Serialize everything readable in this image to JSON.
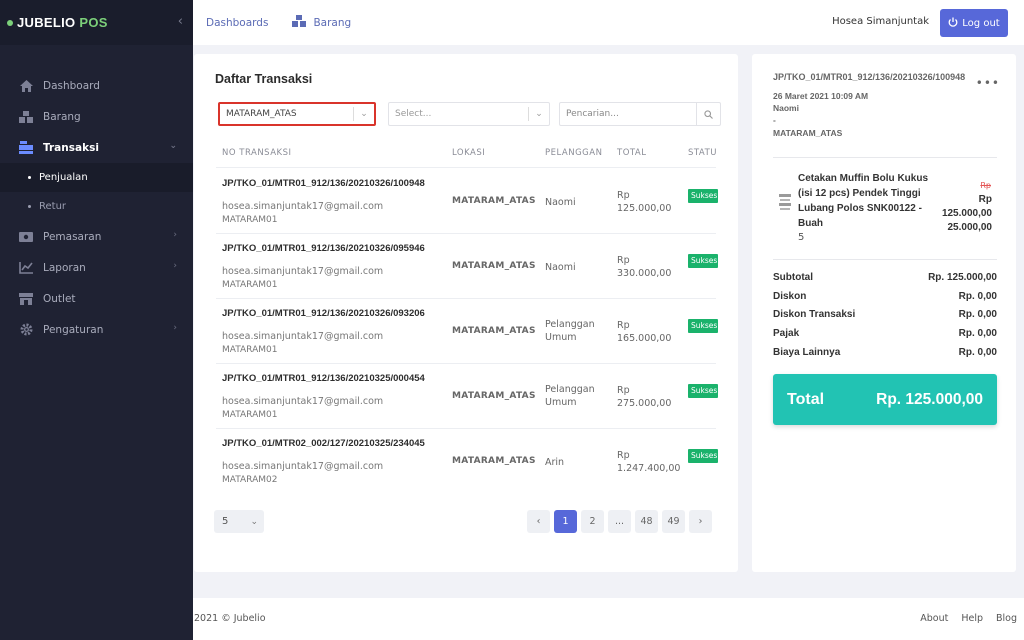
{
  "brand": {
    "name": "JUBELIO",
    "suffix": "POS"
  },
  "sidebar": {
    "items": [
      {
        "label": "Dashboard",
        "icon": "home-icon"
      },
      {
        "label": "Barang",
        "icon": "boxes-icon"
      },
      {
        "label": "Transaksi",
        "icon": "cash-register-icon",
        "sub": [
          {
            "label": "Penjualan"
          },
          {
            "label": "Retur"
          }
        ]
      },
      {
        "label": "Pemasaran",
        "icon": "money-icon"
      },
      {
        "label": "Laporan",
        "icon": "chart-line-icon"
      },
      {
        "label": "Outlet",
        "icon": "store-icon"
      },
      {
        "label": "Pengaturan",
        "icon": "gear-icon"
      }
    ]
  },
  "topbar": {
    "links": [
      {
        "label": "Dashboards"
      },
      {
        "label": "Barang"
      }
    ],
    "user": "Hosea Simanjuntak",
    "logout_label": "Log out"
  },
  "main": {
    "title": "Daftar Transaksi",
    "filters": {
      "outlet_value": "MATARAM_ATAS",
      "select_placeholder": "Select...",
      "search_placeholder": "Pencarian..."
    },
    "columns": [
      "NO TRANSAKSI",
      "LOKASI",
      "PELANGGAN",
      "TOTAL",
      "STATUS"
    ],
    "rows": [
      {
        "no": "JP/TKO_01/MTR01_912/136/20210326/100948",
        "email": "hosea.simanjuntak17@gmail.com",
        "store": "MATARAM01",
        "lokasi": "MATARAM_ATAS",
        "pelanggan": "Naomi",
        "total": "Rp 125.000,00",
        "status": "Sukses"
      },
      {
        "no": "JP/TKO_01/MTR01_912/136/20210326/095946",
        "email": "hosea.simanjuntak17@gmail.com",
        "store": "MATARAM01",
        "lokasi": "MATARAM_ATAS",
        "pelanggan": "Naomi",
        "total": "Rp 330.000,00",
        "status": "Sukses"
      },
      {
        "no": "JP/TKO_01/MTR01_912/136/20210326/093206",
        "email": "hosea.simanjuntak17@gmail.com",
        "store": "MATARAM01",
        "lokasi": "MATARAM_ATAS",
        "pelanggan": "Pelanggan Umum",
        "total": "Rp 165.000,00",
        "status": "Sukses"
      },
      {
        "no": "JP/TKO_01/MTR01_912/136/20210325/000454",
        "email": "hosea.simanjuntak17@gmail.com",
        "store": "MATARAM01",
        "lokasi": "MATARAM_ATAS",
        "pelanggan": "Pelanggan Umum",
        "total": "Rp 275.000,00",
        "status": "Sukses"
      },
      {
        "no": "JP/TKO_01/MTR02_002/127/20210325/234045",
        "email": "hosea.simanjuntak17@gmail.com",
        "store": "MATARAM02",
        "lokasi": "MATARAM_ATAS",
        "pelanggan": "Arin",
        "total": "Rp 1.247.400,00",
        "status": "Sukses"
      }
    ],
    "per_page": "5",
    "pagination": [
      "‹",
      "1",
      "2",
      "...",
      "48",
      "49",
      "›"
    ],
    "current_page": "1"
  },
  "detail": {
    "tx_no": "JP/TKO_01/MTR01_912/136/20210326/100948",
    "date": "26 Maret 2021 10:09 AM",
    "customer": "Naomi",
    "dash": "-",
    "location": "MATARAM_ATAS",
    "item": {
      "name": "Cetakan Muffin Bolu Kukus (isi 12 pcs) Pendek Tinggi Lubang Polos SNK00122 - Buah",
      "qty": "5",
      "old_price": "Rp",
      "price_line1": "Rp",
      "price_line2": "125.000,00",
      "subtotal": "25.000,00"
    },
    "summary": [
      {
        "label": "Subtotal",
        "value": "Rp. 125.000,00"
      },
      {
        "label": "Diskon",
        "value": "Rp. 0,00"
      },
      {
        "label": "Diskon Transaksi",
        "value": "Rp. 0,00"
      },
      {
        "label": "Pajak",
        "value": "Rp. 0,00"
      },
      {
        "label": "Biaya Lainnya",
        "value": "Rp. 0,00"
      }
    ],
    "total_label": "Total",
    "total_value": "Rp. 125.000,00"
  },
  "footer": {
    "copyright": "2021 © Jubelio",
    "links": [
      "About",
      "Help",
      "Blog"
    ]
  },
  "colors": {
    "accent": "#5768d9",
    "success": "#1ab26b",
    "total": "#22c3b3",
    "sidebar": "#1f2233"
  }
}
